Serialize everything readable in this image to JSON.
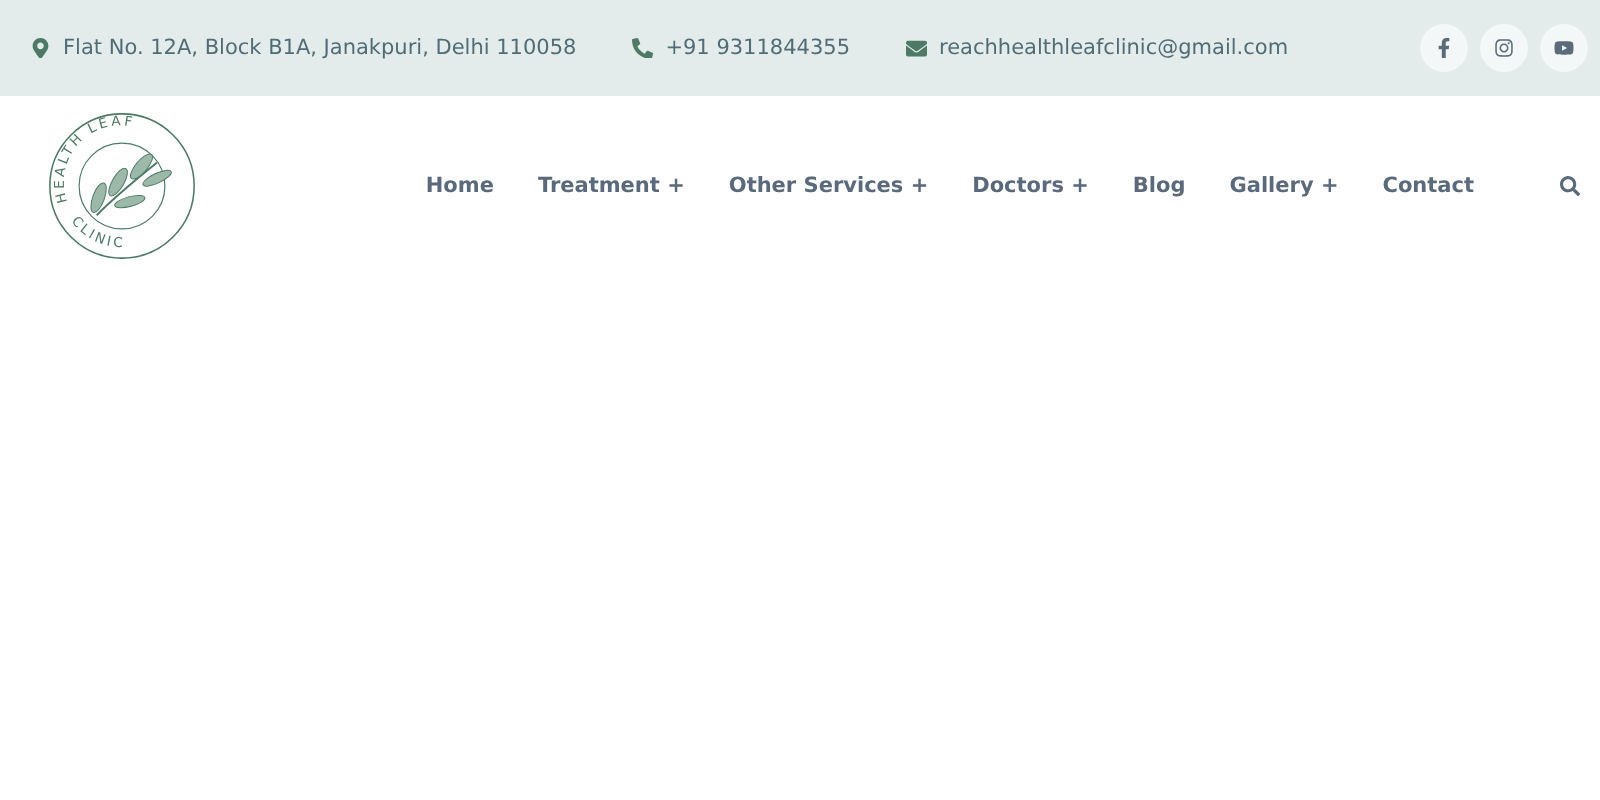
{
  "topbar": {
    "address": "Flat No. 12A, Block B1A, Janakpuri, Delhi 110058",
    "phone": "+91 9311844355",
    "email": "reachhealthleafclinic@gmail.com",
    "social": [
      {
        "kind": "facebook"
      },
      {
        "kind": "instagram"
      },
      {
        "kind": "youtube"
      }
    ]
  },
  "logo": {
    "top_text": "HEALTH LEAF",
    "bottom_text": "CLINIC"
  },
  "nav": [
    {
      "label": "Home"
    },
    {
      "label": "Treatment +"
    },
    {
      "label": "Other Services +"
    },
    {
      "label": "Doctors +"
    },
    {
      "label": "Blog"
    },
    {
      "label": "Gallery +"
    },
    {
      "label": "Contact"
    }
  ]
}
